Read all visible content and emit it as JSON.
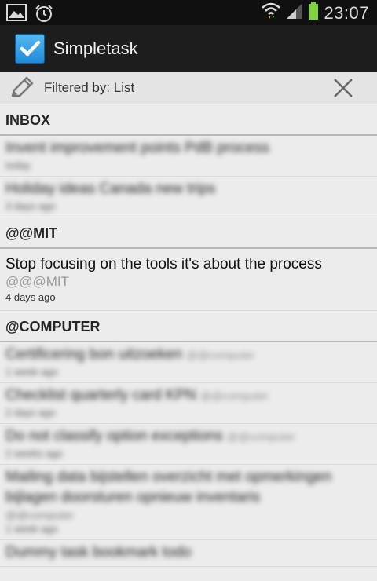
{
  "status_bar": {
    "time": "23:07"
  },
  "app": {
    "title": "Simpletask"
  },
  "filter": {
    "label": "Filtered by: List"
  },
  "sections": [
    {
      "header": "INBOX",
      "tasks": [
        {
          "text": "Invent improvement points PdB process",
          "meta": "today",
          "blurred": true
        },
        {
          "text": "Holiday ideas Canada new trips",
          "meta": "3 days ago",
          "blurred": true
        }
      ]
    },
    {
      "header": "@@MIT",
      "tasks": [
        {
          "text": "Stop focusing on the tools it's about the process",
          "tags": "@@@MIT",
          "meta": "4 days ago",
          "blurred": false
        }
      ]
    },
    {
      "header": "@COMPUTER",
      "tasks": [
        {
          "text": "Certificering bon uitzoeken",
          "tags": "@@computer",
          "meta": "1 week ago",
          "blurred": true
        },
        {
          "text": "Checklist quarterly card KPN",
          "tags": "@@computer",
          "meta": "2 days ago",
          "blurred": true
        },
        {
          "text": "Do not classify option exceptions",
          "tags": "@@computer",
          "meta": "2 weeks ago",
          "blurred": true
        },
        {
          "text": "Mailing data bijstellen overzicht met opmerkingen",
          "tags2": "bijlagen doorsturen opnieuw inventaris",
          "tags": "@@computer",
          "meta": "1 week ago",
          "blurred": true
        }
      ]
    }
  ],
  "partial_row": {
    "text": "Dummy task bookmark todo",
    "blurred": true
  }
}
